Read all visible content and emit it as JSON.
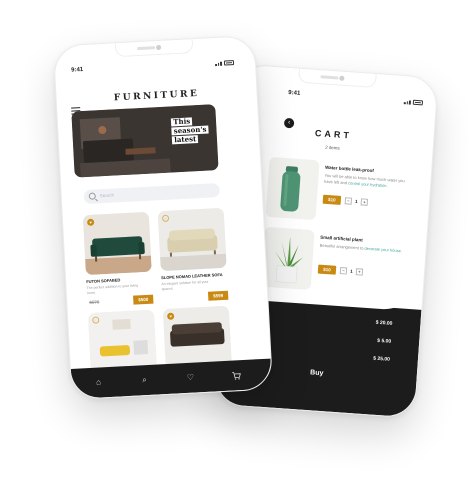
{
  "cart_screen": {
    "status_time": "9:41",
    "title": "CART",
    "item_count": "2 items",
    "items": [
      {
        "name": "Water bottle leak-proof",
        "desc_parts": [
          "You will be able to know how much water you have left and ",
          "control your hydration."
        ],
        "price": "$10",
        "quantity": "1",
        "minus": "−",
        "plus": "+",
        "image_icon": "green-bottle-icon"
      },
      {
        "name": "Small artificial plant",
        "desc_parts": [
          "Beautiful arrangement to ",
          "decorate your house."
        ],
        "price": "$10",
        "quantity": "1",
        "minus": "−",
        "plus": "+",
        "image_icon": "potted-plant-icon"
      }
    ],
    "summary": [
      {
        "label": "otal",
        "value": "$ 20.00"
      },
      {
        "label": "",
        "value": "$ 5.00"
      },
      {
        "label": "",
        "value": "$ 25.00"
      }
    ],
    "buy_label": "Buy"
  },
  "shop_screen": {
    "status_time": "9:41",
    "brand": "FURNITURE",
    "hero_lines": [
      "This",
      "season's",
      "latest"
    ],
    "search_placeholder": "Search",
    "products": [
      {
        "name": "FUTON SOFABED",
        "desc": "The perfect addition to your living room.",
        "old_price": "$576",
        "price": "$500",
        "favorited": true
      },
      {
        "name": "SLOPE NOMAD LEATHER SOFA",
        "desc": "An elegant solution for all your spaces",
        "old_price": "",
        "price": "$599",
        "favorited": false
      },
      {
        "name": "",
        "desc": "",
        "old_price": "",
        "price": "",
        "favorited": false
      },
      {
        "name": "",
        "desc": "",
        "old_price": "",
        "price": "",
        "favorited": true
      }
    ],
    "tabs": [
      "home-icon",
      "search-icon",
      "heart-icon",
      "cart-icon"
    ]
  },
  "colors": {
    "accent": "#c98a13",
    "dark": "#1c1c1c",
    "highlight_text": "#46a89a",
    "sofa_green": "#1f4a3c",
    "sofa_beige": "#d9cfae"
  }
}
